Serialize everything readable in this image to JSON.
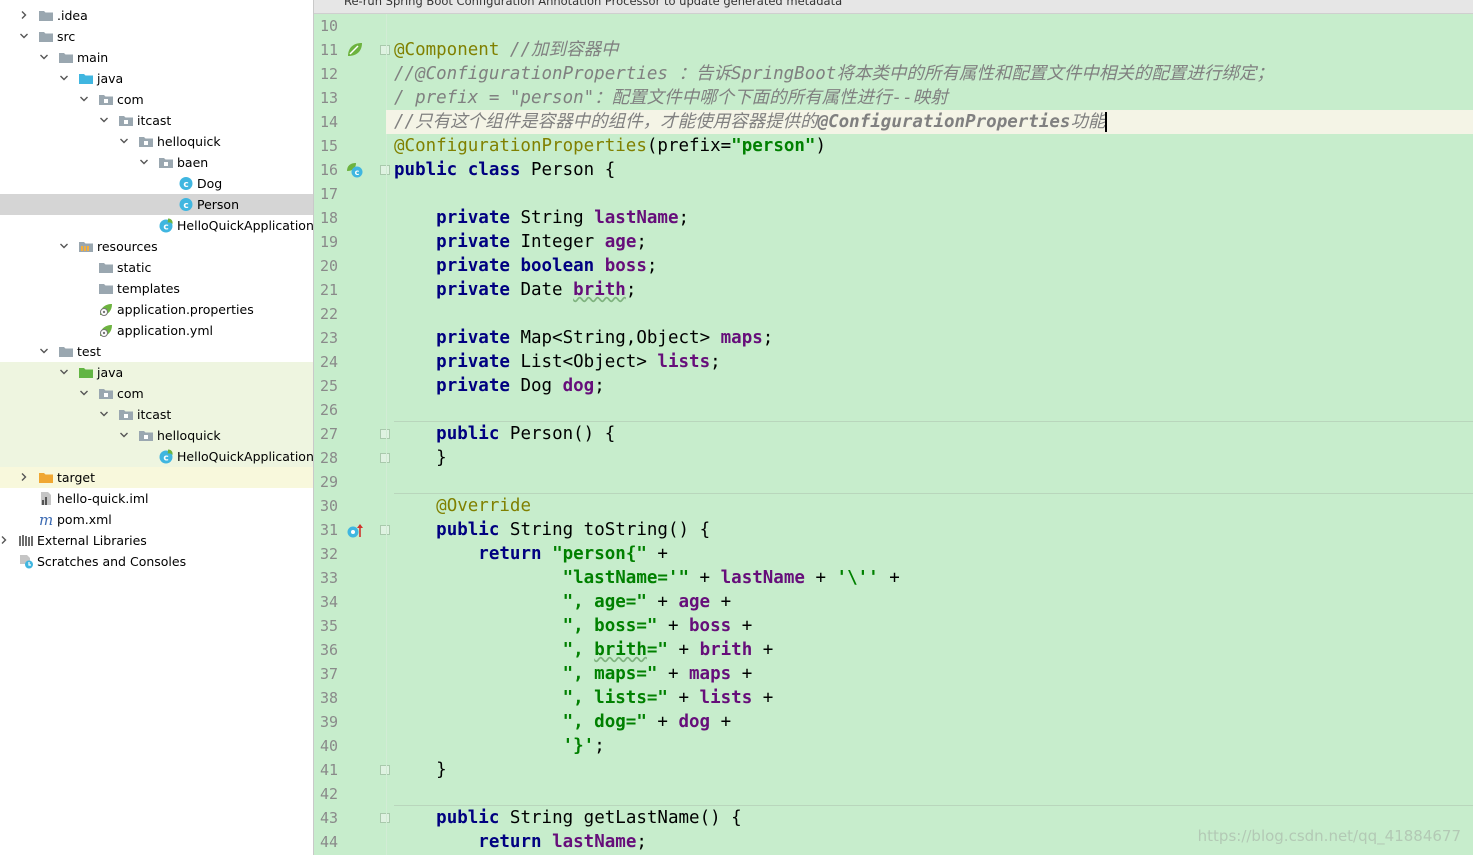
{
  "hint": "Re-run Spring Boot Configuration Annotation Processor to update generated metadata",
  "tree": [
    {
      "label": ".idea",
      "depth": 1,
      "arrow": "right",
      "icon": "folder-icon"
    },
    {
      "label": "src",
      "depth": 1,
      "arrow": "down",
      "icon": "folder-icon"
    },
    {
      "label": "main",
      "depth": 2,
      "arrow": "down",
      "icon": "folder-icon"
    },
    {
      "label": "java",
      "depth": 3,
      "arrow": "down",
      "icon": "source-folder-icon"
    },
    {
      "label": "com",
      "depth": 4,
      "arrow": "down",
      "icon": "package-icon"
    },
    {
      "label": "itcast",
      "depth": 5,
      "arrow": "down",
      "icon": "package-icon"
    },
    {
      "label": "helloquick",
      "depth": 6,
      "arrow": "down",
      "icon": "package-icon"
    },
    {
      "label": "baen",
      "depth": 7,
      "arrow": "down",
      "icon": "package-icon"
    },
    {
      "label": "Dog",
      "depth": 8,
      "arrow": "none",
      "icon": "class-icon"
    },
    {
      "label": "Person",
      "depth": 8,
      "arrow": "none",
      "icon": "class-icon",
      "selected": true
    },
    {
      "label": "HelloQuickApplication",
      "depth": 7,
      "arrow": "none",
      "icon": "spring-class-icon"
    },
    {
      "label": "resources",
      "depth": 3,
      "arrow": "down",
      "icon": "resources-folder-icon"
    },
    {
      "label": "static",
      "depth": 4,
      "arrow": "none",
      "icon": "folder-icon"
    },
    {
      "label": "templates",
      "depth": 4,
      "arrow": "none",
      "icon": "folder-icon"
    },
    {
      "label": "application.properties",
      "depth": 4,
      "arrow": "none",
      "icon": "spring-config-icon"
    },
    {
      "label": "application.yml",
      "depth": 4,
      "arrow": "none",
      "icon": "spring-config-icon"
    },
    {
      "label": "test",
      "depth": 2,
      "arrow": "down",
      "icon": "folder-icon"
    },
    {
      "label": "java",
      "depth": 3,
      "arrow": "down",
      "icon": "test-source-folder-icon",
      "bg": "test"
    },
    {
      "label": "com",
      "depth": 4,
      "arrow": "down",
      "icon": "package-icon",
      "bg": "test"
    },
    {
      "label": "itcast",
      "depth": 5,
      "arrow": "down",
      "icon": "package-icon",
      "bg": "test"
    },
    {
      "label": "helloquick",
      "depth": 6,
      "arrow": "down",
      "icon": "package-icon",
      "bg": "test"
    },
    {
      "label": "HelloQuickApplicationTests",
      "depth": 7,
      "arrow": "none",
      "icon": "spring-class-icon",
      "bg": "test"
    },
    {
      "label": "target",
      "depth": 1,
      "arrow": "right",
      "icon": "excluded-folder-icon",
      "bg": "target"
    },
    {
      "label": "hello-quick.iml",
      "depth": 1,
      "arrow": "none",
      "icon": "iml-file-icon"
    },
    {
      "label": "pom.xml",
      "depth": 1,
      "arrow": "none",
      "icon": "maven-icon"
    },
    {
      "label": "External Libraries",
      "depth": 0,
      "arrow": "right",
      "icon": "libraries-icon"
    },
    {
      "label": "Scratches and Consoles",
      "depth": 0,
      "arrow": "none",
      "icon": "scratches-icon"
    }
  ],
  "editor": {
    "current_line": 14,
    "separators_after": [
      26,
      29,
      42
    ],
    "gutter_icons": {
      "11": "spring-bean-icon",
      "16": "spring-class-gutter-icon",
      "31": "override-method-icon"
    },
    "fold_markers": [
      11,
      16,
      27,
      28,
      31,
      41,
      43
    ],
    "lines": [
      {
        "n": 10,
        "t": []
      },
      {
        "n": 11,
        "t": [
          [
            "ann",
            "@Component"
          ],
          [
            "",
            " "
          ],
          [
            "cmt",
            "//加到容器中"
          ]
        ]
      },
      {
        "n": 12,
        "t": [
          [
            "cmt",
            "//@ConfigurationProperties ：告诉SpringBoot将本类中的所有属性和配置文件中相关的配置进行绑定；"
          ]
        ]
      },
      {
        "n": 13,
        "t": [
          [
            "cmt",
            "/ prefix = \"person\"：配置文件中哪个下面的所有属性进行--映射"
          ]
        ]
      },
      {
        "n": 14,
        "t": [
          [
            "cmt",
            "//只有这个组件是容器中的组件，才能使用容器提供的"
          ],
          [
            "cmtb",
            "@ConfigurationProperties"
          ],
          [
            "cmt",
            "功能"
          ]
        ]
      },
      {
        "n": 15,
        "t": [
          [
            "ann",
            "@ConfigurationProperties"
          ],
          [
            "",
            "(prefix="
          ],
          [
            "str",
            "\"person\""
          ],
          [
            "",
            ")"
          ]
        ]
      },
      {
        "n": 16,
        "t": [
          [
            "kw",
            "public class "
          ],
          [
            "",
            "Person {"
          ]
        ]
      },
      {
        "n": 17,
        "t": []
      },
      {
        "n": 18,
        "t": [
          [
            "",
            "    "
          ],
          [
            "kw",
            "private "
          ],
          [
            "",
            "String "
          ],
          [
            "fld",
            "lastName"
          ],
          [
            "",
            ";"
          ]
        ]
      },
      {
        "n": 19,
        "t": [
          [
            "",
            "    "
          ],
          [
            "kw",
            "private "
          ],
          [
            "",
            "Integer "
          ],
          [
            "fld",
            "age"
          ],
          [
            "",
            ";"
          ]
        ]
      },
      {
        "n": 20,
        "t": [
          [
            "",
            "    "
          ],
          [
            "kw",
            "private boolean "
          ],
          [
            "fld",
            "boss"
          ],
          [
            "",
            ";"
          ]
        ]
      },
      {
        "n": 21,
        "t": [
          [
            "",
            "    "
          ],
          [
            "kw",
            "private "
          ],
          [
            "",
            "Date "
          ],
          [
            "fld wavy",
            "brith"
          ],
          [
            "",
            ";"
          ]
        ]
      },
      {
        "n": 22,
        "t": []
      },
      {
        "n": 23,
        "t": [
          [
            "",
            "    "
          ],
          [
            "kw",
            "private "
          ],
          [
            "",
            "Map<String,Object> "
          ],
          [
            "fld",
            "maps"
          ],
          [
            "",
            ";"
          ]
        ]
      },
      {
        "n": 24,
        "t": [
          [
            "",
            "    "
          ],
          [
            "kw",
            "private "
          ],
          [
            "",
            "List<Object> "
          ],
          [
            "fld",
            "lists"
          ],
          [
            "",
            ";"
          ]
        ]
      },
      {
        "n": 25,
        "t": [
          [
            "",
            "    "
          ],
          [
            "kw",
            "private "
          ],
          [
            "",
            "Dog "
          ],
          [
            "fld",
            "dog"
          ],
          [
            "",
            ";"
          ]
        ]
      },
      {
        "n": 26,
        "t": []
      },
      {
        "n": 27,
        "t": [
          [
            "",
            "    "
          ],
          [
            "kw",
            "public "
          ],
          [
            "",
            "Person() {"
          ]
        ]
      },
      {
        "n": 28,
        "t": [
          [
            "",
            "    }"
          ]
        ]
      },
      {
        "n": 29,
        "t": []
      },
      {
        "n": 30,
        "t": [
          [
            "",
            "    "
          ],
          [
            "ann",
            "@Override"
          ]
        ]
      },
      {
        "n": 31,
        "t": [
          [
            "",
            "    "
          ],
          [
            "kw",
            "public "
          ],
          [
            "",
            "String toString() {"
          ]
        ]
      },
      {
        "n": 32,
        "t": [
          [
            "",
            "        "
          ],
          [
            "kw",
            "return "
          ],
          [
            "str",
            "\"person{\""
          ],
          [
            "",
            " +"
          ]
        ]
      },
      {
        "n": 33,
        "t": [
          [
            "",
            "                "
          ],
          [
            "str",
            "\"lastName='\""
          ],
          [
            "",
            " + "
          ],
          [
            "fld",
            "lastName"
          ],
          [
            "",
            " + "
          ],
          [
            "str",
            "'\\''"
          ],
          [
            "",
            " +"
          ]
        ]
      },
      {
        "n": 34,
        "t": [
          [
            "",
            "                "
          ],
          [
            "str",
            "\", age=\""
          ],
          [
            "",
            " + "
          ],
          [
            "fld",
            "age"
          ],
          [
            "",
            " +"
          ]
        ]
      },
      {
        "n": 35,
        "t": [
          [
            "",
            "                "
          ],
          [
            "str",
            "\", boss=\""
          ],
          [
            "",
            " + "
          ],
          [
            "fld",
            "boss"
          ],
          [
            "",
            " +"
          ]
        ]
      },
      {
        "n": 36,
        "t": [
          [
            "",
            "                "
          ],
          [
            "str",
            "\", "
          ],
          [
            "str wavy",
            "brith"
          ],
          [
            "str",
            "=\""
          ],
          [
            "",
            " + "
          ],
          [
            "fld",
            "brith"
          ],
          [
            "",
            " +"
          ]
        ]
      },
      {
        "n": 37,
        "t": [
          [
            "",
            "                "
          ],
          [
            "str",
            "\", maps=\""
          ],
          [
            "",
            " + "
          ],
          [
            "fld",
            "maps"
          ],
          [
            "",
            " +"
          ]
        ]
      },
      {
        "n": 38,
        "t": [
          [
            "",
            "                "
          ],
          [
            "str",
            "\", lists=\""
          ],
          [
            "",
            " + "
          ],
          [
            "fld",
            "lists"
          ],
          [
            "",
            " +"
          ]
        ]
      },
      {
        "n": 39,
        "t": [
          [
            "",
            "                "
          ],
          [
            "str",
            "\", dog=\""
          ],
          [
            "",
            " + "
          ],
          [
            "fld",
            "dog"
          ],
          [
            "",
            " +"
          ]
        ]
      },
      {
        "n": 40,
        "t": [
          [
            "",
            "                "
          ],
          [
            "str",
            "'}'"
          ],
          [
            "",
            ";"
          ]
        ]
      },
      {
        "n": 41,
        "t": [
          [
            "",
            "    }"
          ]
        ]
      },
      {
        "n": 42,
        "t": []
      },
      {
        "n": 43,
        "t": [
          [
            "",
            "    "
          ],
          [
            "kw",
            "public "
          ],
          [
            "",
            "String getLastName() {"
          ]
        ]
      },
      {
        "n": 44,
        "t": [
          [
            "",
            "        "
          ],
          [
            "kw",
            "return "
          ],
          [
            "fld",
            "lastName"
          ],
          [
            "",
            ";"
          ]
        ]
      }
    ]
  },
  "watermark": "https://blog.csdn.net/qq_41884677",
  "colors": {
    "editor_bg": "#c7edcc",
    "current_line_bg": "#f4f4e6",
    "keyword": "#000080",
    "field": "#660e7a",
    "string": "#008000",
    "annotation": "#808000",
    "comment": "#808080",
    "tree_selected": "#d5d5d5"
  }
}
